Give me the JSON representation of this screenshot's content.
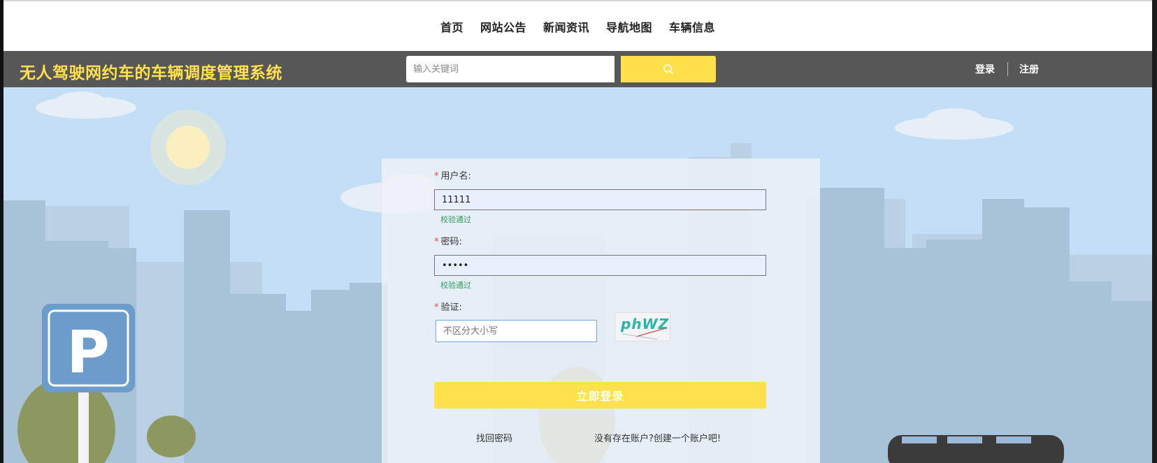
{
  "nav": {
    "items": [
      "首页",
      "网站公告",
      "新闻资讯",
      "导航地图",
      "车辆信息"
    ]
  },
  "header": {
    "site_title": "无人驾驶网约车的车辆调度管理系统",
    "search_placeholder": "输入关键词",
    "login_link": "登录",
    "register_link": "注册"
  },
  "form": {
    "required_mark": "*",
    "username_label": "用户名:",
    "username_value": "11111",
    "username_hint": "校验通过",
    "password_label": "密码:",
    "password_value": "•••••",
    "password_hint": "校验通过",
    "captcha_label": "验证:",
    "captcha_placeholder": "不区分大小写",
    "captcha_text": "phWZ",
    "login_button": "立即登录",
    "forgot_link": "找回密码",
    "register_link": "没有存在账户?创建一个账户吧!"
  },
  "colors": {
    "accent": "#ffe04d",
    "header_bg": "#575757",
    "sky": "#c4dff5",
    "hint_green": "#2f9e58"
  },
  "icons": {
    "search": "search-icon",
    "parking": "parking-sign-icon"
  }
}
